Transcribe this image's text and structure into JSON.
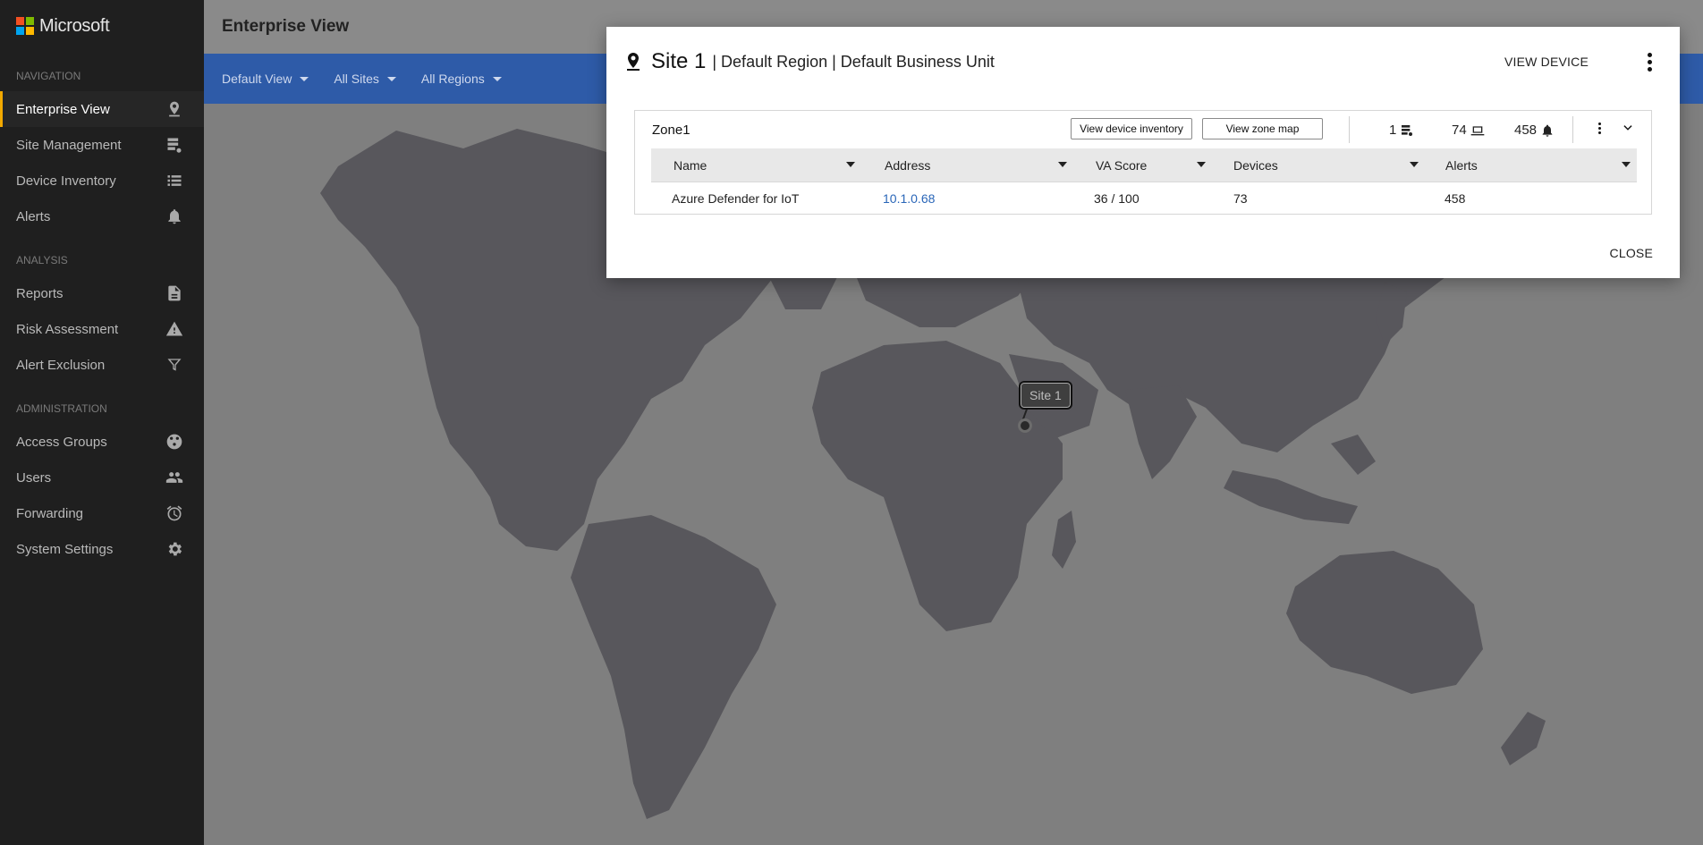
{
  "app": {
    "brand": "Microsoft"
  },
  "sidebar": {
    "sections": [
      {
        "title": "NAVIGATION",
        "items": [
          {
            "label": "Enterprise View",
            "icon": "map-pin-icon",
            "active": true
          },
          {
            "label": "Site Management",
            "icon": "server-icon"
          },
          {
            "label": "Device Inventory",
            "icon": "list-icon"
          },
          {
            "label": "Alerts",
            "icon": "bell-icon"
          }
        ]
      },
      {
        "title": "ANALYSIS",
        "items": [
          {
            "label": "Reports",
            "icon": "document-icon"
          },
          {
            "label": "Risk Assessment",
            "icon": "warning-icon"
          },
          {
            "label": "Alert Exclusion",
            "icon": "filter-icon"
          }
        ]
      },
      {
        "title": "ADMINISTRATION",
        "items": [
          {
            "label": "Access Groups",
            "icon": "group-circle-icon"
          },
          {
            "label": "Users",
            "icon": "users-icon"
          },
          {
            "label": "Forwarding",
            "icon": "alarm-clock-icon"
          },
          {
            "label": "System Settings",
            "icon": "gear-icon"
          }
        ]
      }
    ]
  },
  "header": {
    "title": "Enterprise View"
  },
  "filters": [
    {
      "label": "Default View"
    },
    {
      "label": "All Sites"
    },
    {
      "label": "All Regions"
    }
  ],
  "map": {
    "pin_label": "Site 1"
  },
  "dialog": {
    "title": "Site 1",
    "subtitle": "| Default Region | Default Business Unit",
    "view_device": "VIEW DEVICE",
    "close": "CLOSE",
    "zone": {
      "name": "Zone1",
      "btn_inventory": "View device inventory",
      "btn_zonemap": "View zone map",
      "stats": {
        "sensors": "1",
        "devices": "74",
        "alerts": "458"
      },
      "columns": [
        "Name",
        "Address",
        "VA Score",
        "Devices",
        "Alerts"
      ],
      "rows": [
        {
          "name": "Azure Defender for IoT",
          "address": "10.1.0.68",
          "va_score": "36 / 100",
          "devices": "73",
          "alerts": "458"
        }
      ]
    }
  },
  "colors": {
    "accent": "#f2a900",
    "filterbar": "#2e5ba8",
    "link": "#2a66b8"
  }
}
